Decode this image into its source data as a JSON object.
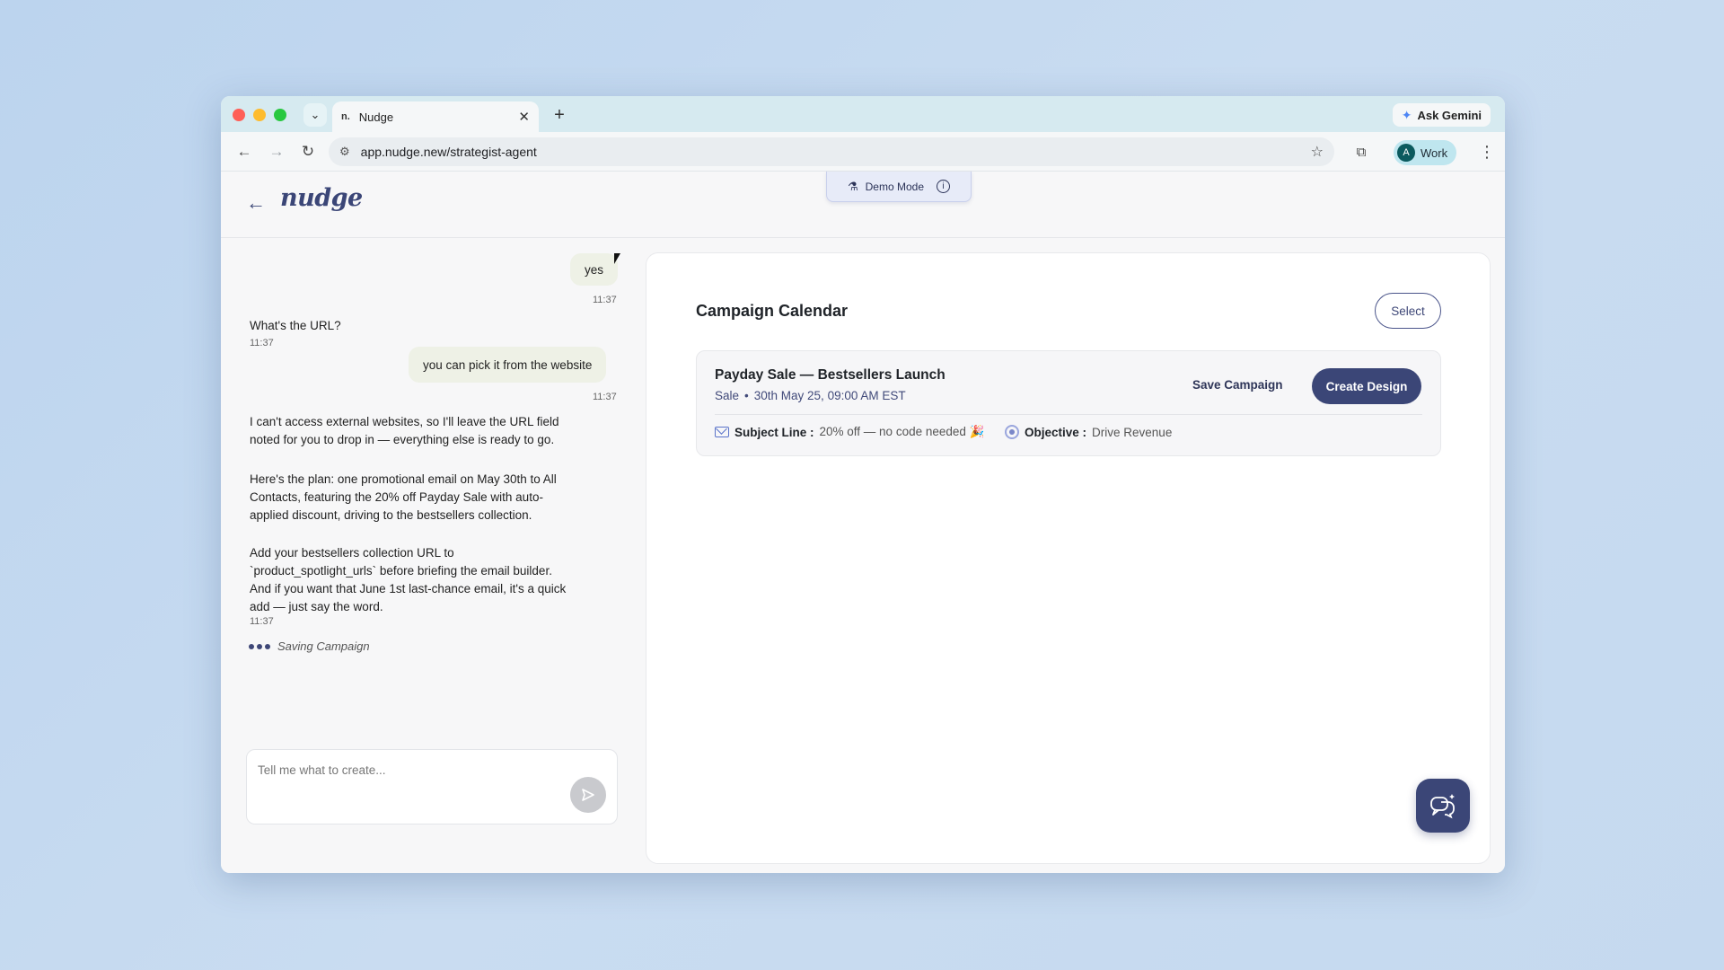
{
  "browser": {
    "tab_title": "Nudge",
    "tab_favicon": "n.",
    "new_tab_symbol": "+",
    "ask_gemini_label": "Ask Gemini",
    "url": "app.nudge.new/strategist-agent",
    "profile_initial": "A",
    "profile_label": "Work"
  },
  "app": {
    "logo": "nudge",
    "demo_mode_label": "Demo Mode"
  },
  "chat": {
    "messages": [
      {
        "role": "user",
        "text": "yes",
        "time": "11:37"
      },
      {
        "role": "assistant",
        "text": "What's the URL?",
        "time": "11:37"
      },
      {
        "role": "user",
        "text": "you can pick it from the website",
        "time": "11:37"
      },
      {
        "role": "assistant",
        "paragraphs": [
          "I can't access external websites, so I'll leave the URL field noted for you to drop in — everything else is ready to go.",
          "Here's the plan: one promotional email on May 30th to All Contacts, featuring the 20% off Payday Sale with auto-applied discount, driving to the bestsellers collection.",
          "Add your bestsellers collection URL to `product_spotlight_urls` before briefing the email builder. And if you want that June 1st last-chance email, it's a quick add — just say the word."
        ],
        "time": "11:37"
      }
    ],
    "status_text": "Saving Campaign",
    "input_placeholder": "Tell me what to create..."
  },
  "calendar": {
    "title": "Campaign Calendar",
    "select_label": "Select",
    "campaign": {
      "title": "Payday Sale — Bestsellers Launch",
      "type": "Sale",
      "separator": "•",
      "schedule": "30th May 25, 09:00 AM EST",
      "save_label": "Save Campaign",
      "create_label": "Create Design",
      "subject_label": "Subject Line :",
      "subject_value": "20% off — no code needed 🎉",
      "objective_label": "Objective :",
      "objective_value": "Drive Revenue"
    }
  },
  "colors": {
    "brand": "#3b4677",
    "user_bubble": "#eef1e6",
    "tab_strip": "#d6eaf0"
  }
}
